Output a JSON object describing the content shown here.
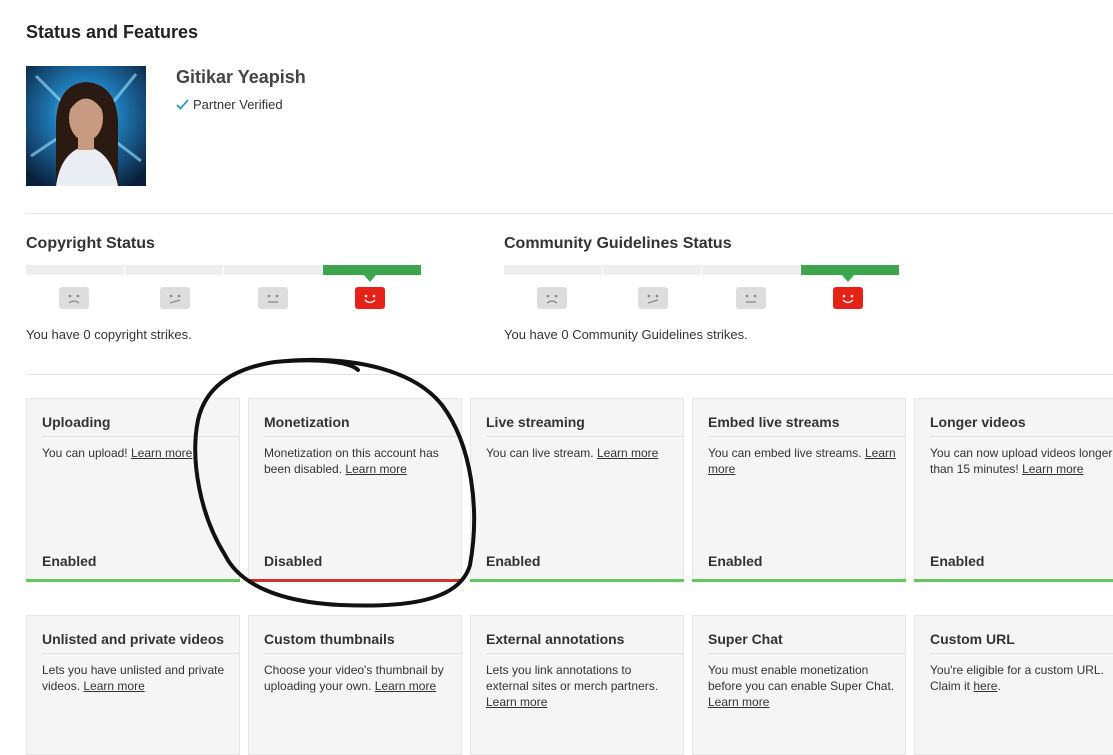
{
  "page": {
    "title": "Status and Features"
  },
  "channel": {
    "name": "Gitikar Yeapish",
    "verified_label": "Partner Verified"
  },
  "copyright": {
    "title": "Copyright Status",
    "strikes_text": "You have 0 copyright strikes."
  },
  "community": {
    "title": "Community Guidelines Status",
    "strikes_text": "You have 0 Community Guidelines strikes."
  },
  "colors": {
    "enabled": "#3ea54f",
    "disabled": "#d32f2f",
    "accent_red": "#e62117"
  },
  "features_row1": [
    {
      "title": "Uploading",
      "desc": "You can upload!",
      "link": "Learn more",
      "status": "Enabled",
      "state": "enabled"
    },
    {
      "title": "Monetization",
      "desc": "Monetization on this account has been disabled.",
      "link": "Learn more",
      "status": "Disabled",
      "state": "disabled"
    },
    {
      "title": "Live streaming",
      "desc": "You can live stream.",
      "link": "Learn more",
      "status": "Enabled",
      "state": "enabled"
    },
    {
      "title": "Embed live streams",
      "desc": "You can embed live streams.",
      "link": "Learn more",
      "status": "Enabled",
      "state": "enabled"
    },
    {
      "title": "Longer videos",
      "desc": "You can now upload videos longer than 15 minutes!",
      "link": "Learn more",
      "status": "Enabled",
      "state": "enabled"
    }
  ],
  "features_row2": [
    {
      "title": "Unlisted and private videos",
      "desc": "Lets you have unlisted and private videos.",
      "link": "Learn more"
    },
    {
      "title": "Custom thumbnails",
      "desc": "Choose your video's thumbnail by uploading your own.",
      "link": "Learn more"
    },
    {
      "title": "External annotations",
      "desc": "Lets you link annotations to external sites or merch partners.",
      "link": "Learn more"
    },
    {
      "title": "Super Chat",
      "desc": "You must enable monetization before you can enable Super Chat.",
      "link": "Learn more"
    },
    {
      "title": "Custom URL",
      "desc": "You're eligible for a custom URL. Claim it",
      "link": "here",
      "suffix": "."
    }
  ]
}
